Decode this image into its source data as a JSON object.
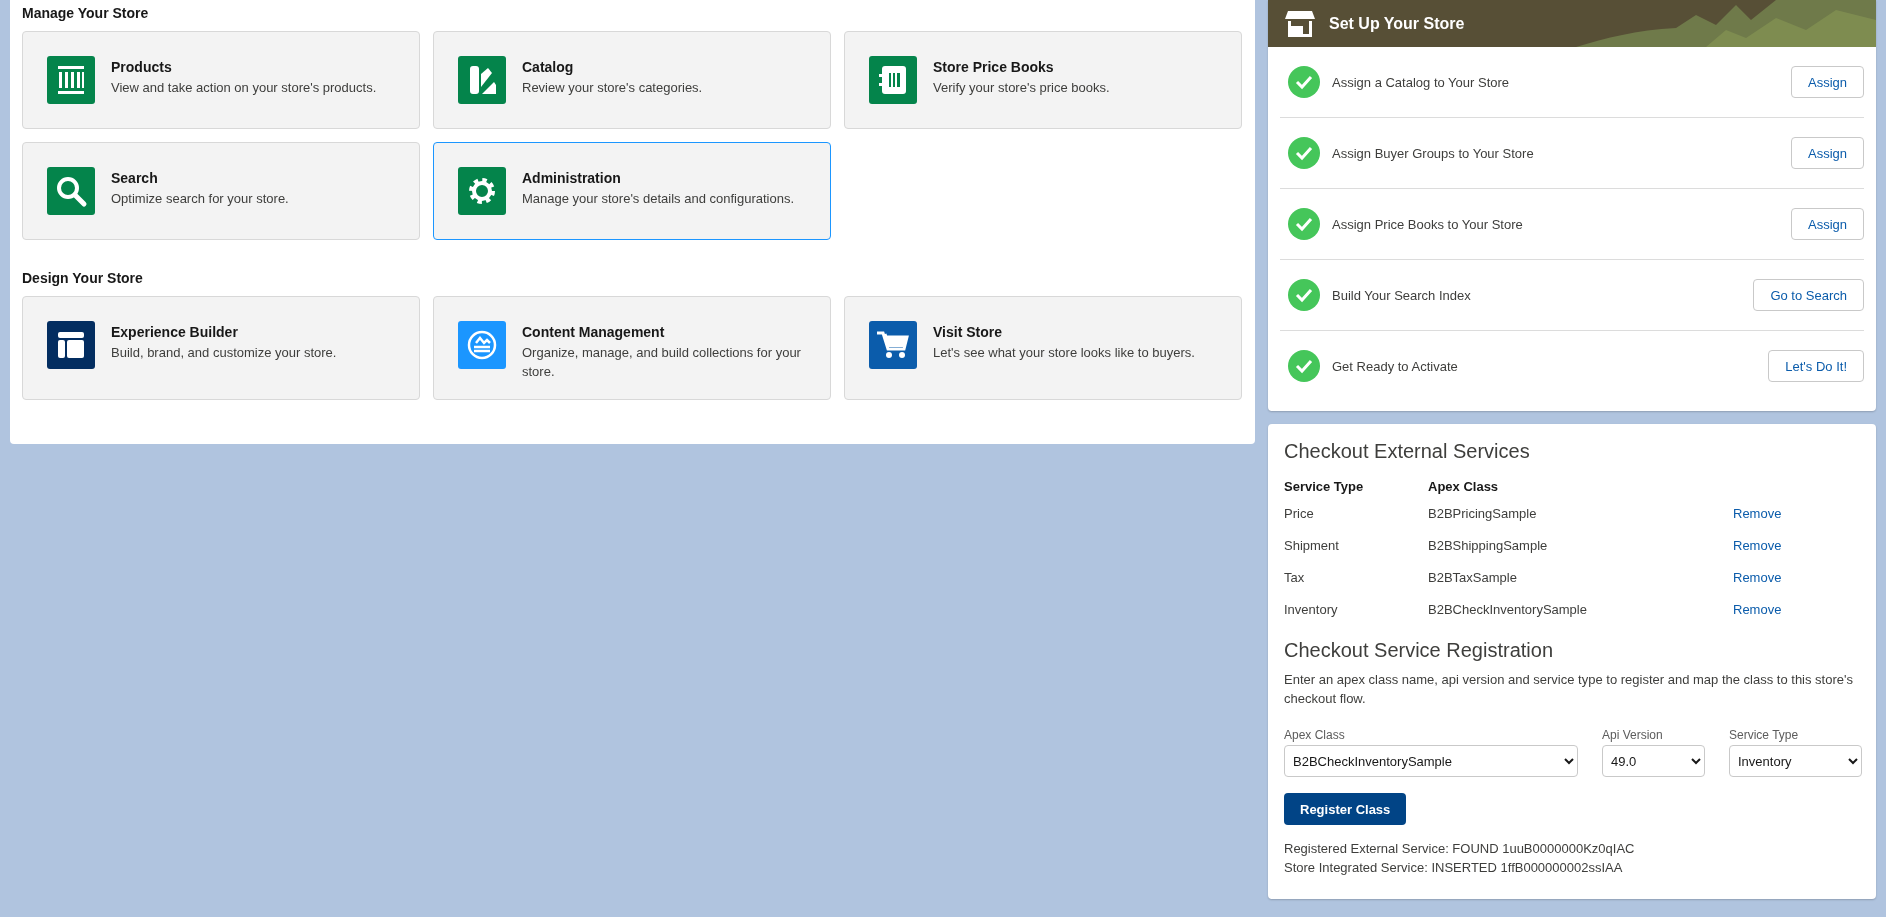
{
  "manage_section": {
    "title": "Manage Your Store",
    "cards": [
      {
        "title": "Products",
        "description": "View and take action on your store's products.",
        "kind": "products",
        "color": "#04844b",
        "selected": false
      },
      {
        "title": "Catalog",
        "description": "Review your store's categories.",
        "kind": "catalog",
        "color": "#04844b",
        "selected": false
      },
      {
        "title": "Store Price Books",
        "description": "Verify your store's price books.",
        "kind": "pricebook",
        "color": "#04844b",
        "selected": false
      },
      {
        "title": "Search",
        "description": "Optimize search for your store.",
        "kind": "search",
        "color": "#04844b",
        "selected": false
      },
      {
        "title": "Administration",
        "description": "Manage your store's details and configurations.",
        "kind": "gear",
        "color": "#04844b",
        "selected": true
      }
    ]
  },
  "design_section": {
    "title": "Design Your Store",
    "cards": [
      {
        "title": "Experience Builder",
        "description": "Build, brand, and customize your store.",
        "kind": "layout",
        "color": "#032d60",
        "selected": false
      },
      {
        "title": "Content Management",
        "description": "Organize, manage, and build collections for your store.",
        "kind": "content",
        "color": "#1b96ff",
        "selected": false
      },
      {
        "title": "Visit Store",
        "description": "Let's see what your store looks like to buyers.",
        "kind": "cart",
        "color": "#0b5cab",
        "selected": false
      }
    ]
  },
  "setup": {
    "title": "Set Up Your Store",
    "steps": [
      {
        "label": "Assign a Catalog to Your Store",
        "done": true,
        "button": "Assign"
      },
      {
        "label": "Assign Buyer Groups to Your Store",
        "done": true,
        "button": "Assign"
      },
      {
        "label": "Assign Price Books to Your Store",
        "done": true,
        "button": "Assign"
      },
      {
        "label": "Build Your Search Index",
        "done": true,
        "button": "Go to Search"
      },
      {
        "label": "Get Ready to Activate",
        "done": true,
        "button": "Let's Do It!"
      }
    ]
  },
  "external_services": {
    "title": "Checkout External Services",
    "columns": [
      "Service Type",
      "Apex Class"
    ],
    "rows": [
      {
        "service_type": "Price",
        "apex_class": "B2BPricingSample",
        "action": "Remove"
      },
      {
        "service_type": "Shipment",
        "apex_class": "B2BShippingSample",
        "action": "Remove"
      },
      {
        "service_type": "Tax",
        "apex_class": "B2BTaxSample",
        "action": "Remove"
      },
      {
        "service_type": "Inventory",
        "apex_class": "B2BCheckInventorySample",
        "action": "Remove"
      }
    ]
  },
  "registration": {
    "title": "Checkout Service Registration",
    "description": "Enter an apex class name, api version and service type to register and map the class to this store's checkout flow.",
    "fields": [
      {
        "label": "Apex Class",
        "value": "B2BCheckInventorySample"
      },
      {
        "label": "Api Version",
        "value": "49.0"
      },
      {
        "label": "Service Type",
        "value": "Inventory"
      }
    ],
    "button": "Register Class",
    "results": [
      "Registered External Service: FOUND 1uuB0000000Kz0qIAC",
      "Store Integrated Service: INSERTED 1ffB000000002ssIAA"
    ]
  }
}
